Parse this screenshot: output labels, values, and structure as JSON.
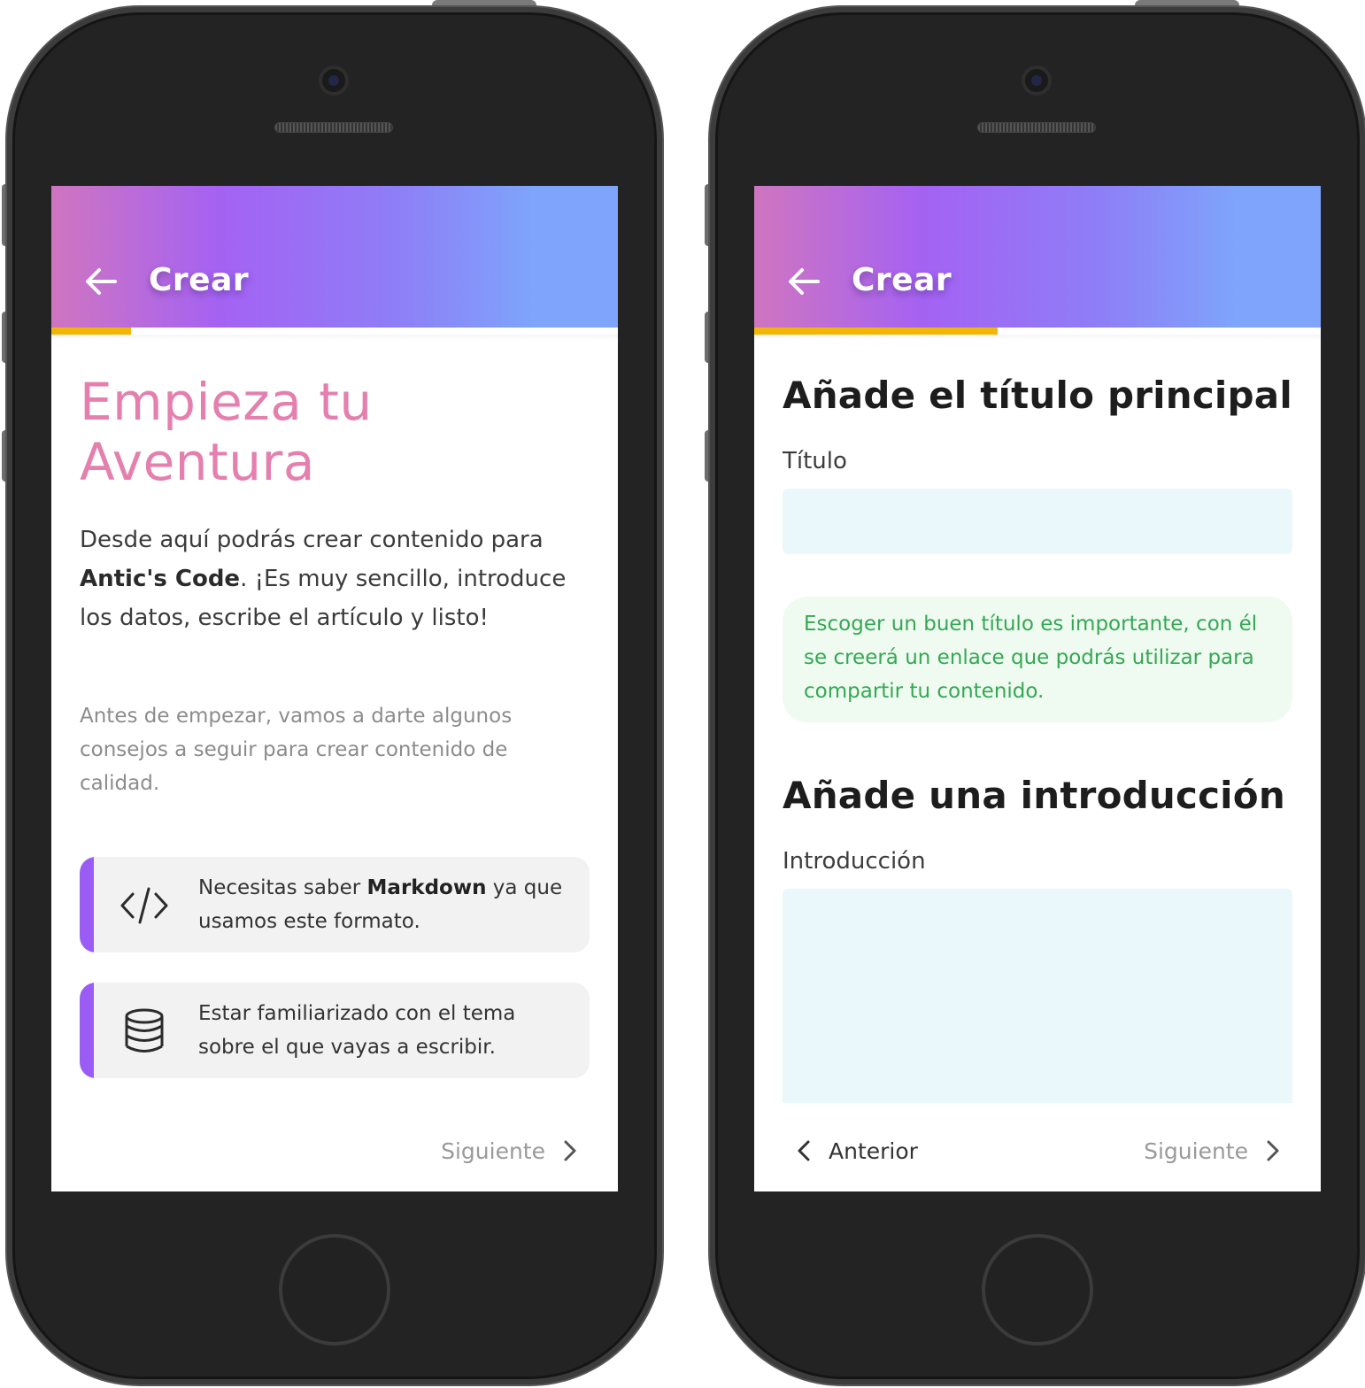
{
  "colors": {
    "header_gradient": [
      "#cf75c0",
      "#a462f3",
      "#8f7df7",
      "#7ea4fb"
    ],
    "progress": "#f2b705",
    "hero_title": "#e47fae",
    "card_accent": "#9b5cf6",
    "hint_text": "#34a853",
    "input_bg": "#eaf8fc"
  },
  "screens": [
    {
      "header": {
        "back_icon": "arrow-left-icon",
        "title": "Crear"
      },
      "progress": 0.14,
      "hero_title": "Empieza tu Aventura",
      "intro": {
        "part1": "Desde aquí podrás crear contenido para ",
        "brand": "Antic's Code",
        "part2": ". ¡Es muy sencillo, introduce los datos, escribe el artículo y listo!"
      },
      "subtext": "Antes de empezar, vamos a darte algunos consejos a seguir para crear contenido de calidad.",
      "tips": [
        {
          "icon": "code-icon",
          "before": "Necesitas saber ",
          "bold": "Markdown",
          "after": " ya que usamos este formato."
        },
        {
          "icon": "database-icon",
          "text": "Estar familiarizado con el tema sobre el que vayas a escribir."
        }
      ],
      "nav": {
        "next_label": "Siguiente",
        "next_icon": "chevron-right-icon"
      }
    },
    {
      "header": {
        "back_icon": "arrow-left-icon",
        "title": "Crear"
      },
      "progress": 0.43,
      "title_section": {
        "heading": "Añade el título principal",
        "label": "Título",
        "value": "",
        "hint": "Escoger un buen título es importante, con él se creerá un enlace que podrás utilizar para compartir tu contenido."
      },
      "intro_section": {
        "heading": "Añade una introducción",
        "label": "Introducción",
        "value": ""
      },
      "nav": {
        "prev_label": "Anterior",
        "prev_icon": "chevron-left-icon",
        "next_label": "Siguiente",
        "next_icon": "chevron-right-icon"
      }
    }
  ]
}
